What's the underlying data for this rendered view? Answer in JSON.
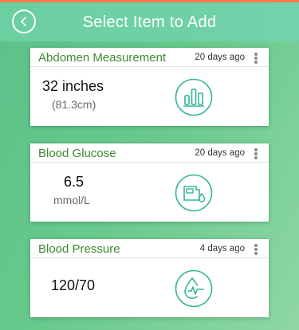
{
  "header": {
    "title": "Select Item to Add",
    "back_icon": "chevron-left-icon"
  },
  "colors": {
    "accent_green": "#3e8a32",
    "icon_teal": "#35b598",
    "topbar": "#6ccfa0",
    "top_strip": "#ff7a4a"
  },
  "cards": [
    {
      "title": "Abdomen Measurement",
      "time": "20 days ago",
      "value": "32 inches",
      "sub": "(81.3cm)",
      "icon": "bar-chart-icon"
    },
    {
      "title": "Blood Glucose",
      "time": "20 days ago",
      "value": "6.5",
      "sub": "mmol/L",
      "icon": "glucose-meter-icon"
    },
    {
      "title": "Blood Pressure",
      "time": "4 days ago",
      "value": "120/70",
      "sub": "",
      "icon": "heart-rate-drop-icon"
    }
  ]
}
